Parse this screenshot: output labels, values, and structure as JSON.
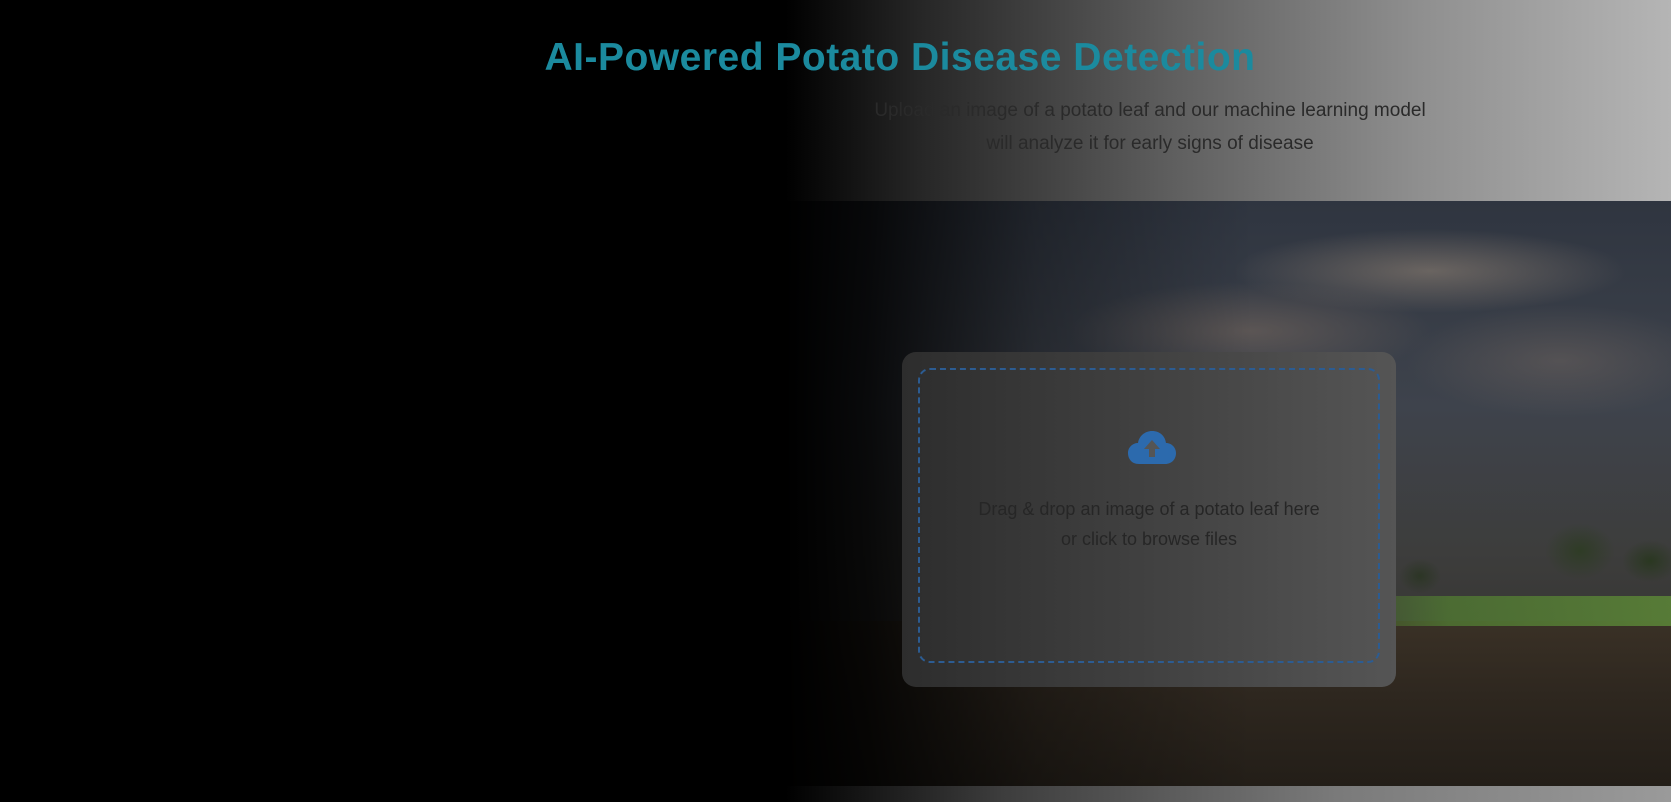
{
  "header": {
    "title": "AI-Powered Potato Disease Detection",
    "subtitle_line1": "Upload an image of a potato leaf and our machine learning model",
    "subtitle_line2": "will analyze it for early signs of disease"
  },
  "upload": {
    "icon": "cloud-upload-icon",
    "text_line1": "Drag & drop an image of a potato leaf here",
    "text_line2": "or click to browse files"
  },
  "colors": {
    "title": "#1b8a9e",
    "accent": "#2c6aad",
    "dropzone_border": "#2c5c92"
  }
}
